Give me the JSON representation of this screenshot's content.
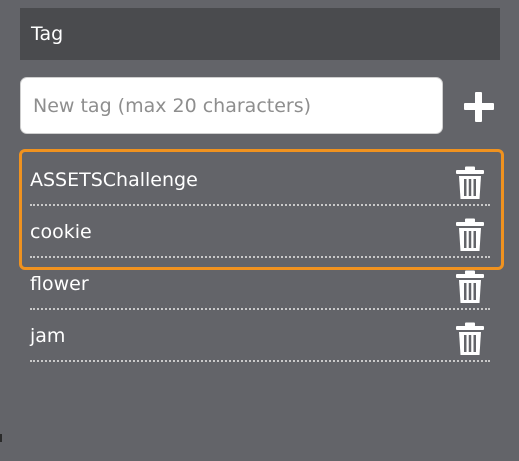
{
  "header": {
    "title": "Tag"
  },
  "new_tag": {
    "placeholder": "New tag (max 20 characters)",
    "value": ""
  },
  "add_button": {
    "icon": "plus-icon"
  },
  "highlight_color": "#f0921f",
  "tags": [
    {
      "label": "ASSETSChallenge",
      "highlighted": true,
      "icon": "trash-icon"
    },
    {
      "label": "cookie",
      "highlighted": true,
      "icon": "trash-icon"
    },
    {
      "label": "flower",
      "highlighted": false,
      "icon": "trash-icon"
    },
    {
      "label": "jam",
      "highlighted": false,
      "icon": "trash-icon"
    }
  ]
}
